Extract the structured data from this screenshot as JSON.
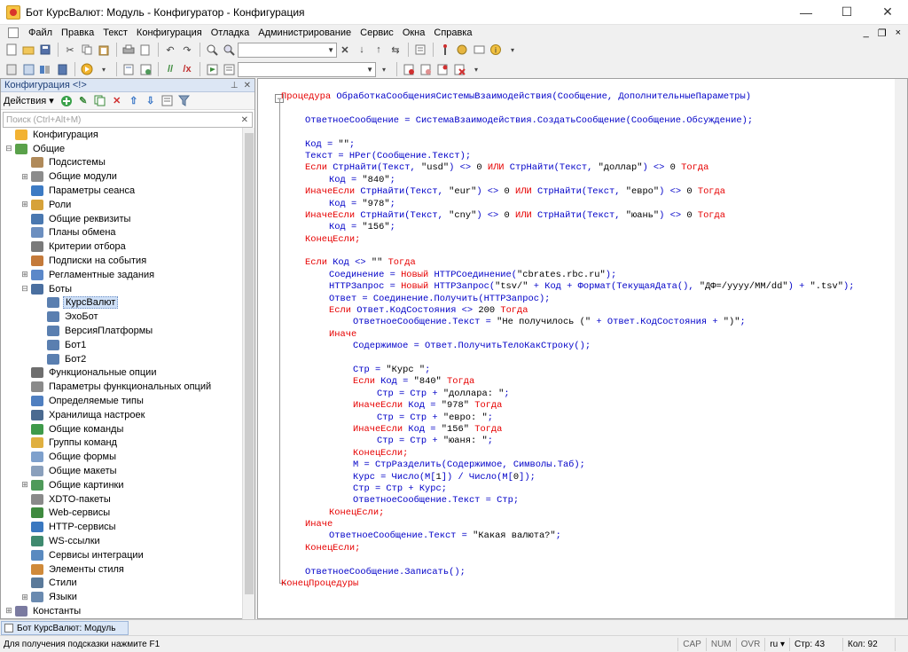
{
  "window": {
    "title": "Бот КурсВалют: Модуль - Конфигуратор - Конфигурация",
    "minimize": "—",
    "maximize": "☐",
    "close": "✕"
  },
  "menu": {
    "items": [
      "Файл",
      "Правка",
      "Текст",
      "Конфигурация",
      "Отладка",
      "Администрирование",
      "Сервис",
      "Окна",
      "Справка"
    ],
    "mdi_minimize": "_",
    "mdi_restore": "❐",
    "mdi_close": "×"
  },
  "config_panel": {
    "title": "Конфигурация <!>",
    "actions_label": "Действия ▾",
    "search_placeholder": "Поиск (Ctrl+Alt+M)",
    "tree": [
      {
        "label": "Конфигурация",
        "level": 0,
        "expander": "",
        "icon": "config-root-icon",
        "color": "#f2b233"
      },
      {
        "label": "Общие",
        "level": 0,
        "expander": "⊟",
        "icon": "common-icon",
        "color": "#5aa14a"
      },
      {
        "label": "Подсистемы",
        "level": 1,
        "expander": "",
        "icon": "subsystems-icon",
        "color": "#b08a5a"
      },
      {
        "label": "Общие модули",
        "level": 1,
        "expander": "⊞",
        "icon": "common-modules-icon",
        "color": "#8c8c8c"
      },
      {
        "label": "Параметры сеанса",
        "level": 1,
        "expander": "",
        "icon": "session-params-icon",
        "color": "#3d7bc4"
      },
      {
        "label": "Роли",
        "level": 1,
        "expander": "⊞",
        "icon": "roles-icon",
        "color": "#d6a23a"
      },
      {
        "label": "Общие реквизиты",
        "level": 1,
        "expander": "",
        "icon": "common-attributes-icon",
        "color": "#4a78b0"
      },
      {
        "label": "Планы обмена",
        "level": 1,
        "expander": "",
        "icon": "exchange-plans-icon",
        "color": "#6c8fc0"
      },
      {
        "label": "Критерии отбора",
        "level": 1,
        "expander": "",
        "icon": "filter-criteria-icon",
        "color": "#7a7a7a"
      },
      {
        "label": "Подписки на события",
        "level": 1,
        "expander": "",
        "icon": "event-subscriptions-icon",
        "color": "#c47a3a"
      },
      {
        "label": "Регламентные задания",
        "level": 1,
        "expander": "⊞",
        "icon": "scheduled-jobs-icon",
        "color": "#5b88c9"
      },
      {
        "label": "Боты",
        "level": 1,
        "expander": "⊟",
        "icon": "bots-icon",
        "color": "#4a6fa0"
      },
      {
        "label": "КурсВалют",
        "level": 2,
        "expander": "",
        "icon": "bot-icon",
        "color": "#5a7fb0",
        "selected": true
      },
      {
        "label": "ЭхоБот",
        "level": 2,
        "expander": "",
        "icon": "bot-icon",
        "color": "#5a7fb0"
      },
      {
        "label": "ВерсияПлатформы",
        "level": 2,
        "expander": "",
        "icon": "bot-icon",
        "color": "#5a7fb0"
      },
      {
        "label": "Бот1",
        "level": 2,
        "expander": "",
        "icon": "bot-icon",
        "color": "#5a7fb0"
      },
      {
        "label": "Бот2",
        "level": 2,
        "expander": "",
        "icon": "bot-icon",
        "color": "#5a7fb0"
      },
      {
        "label": "Функциональные опции",
        "level": 1,
        "expander": "",
        "icon": "functional-options-icon",
        "color": "#6e6e6e"
      },
      {
        "label": "Параметры функциональных опций",
        "level": 1,
        "expander": "",
        "icon": "functional-option-params-icon",
        "color": "#8a8a8a"
      },
      {
        "label": "Определяемые типы",
        "level": 1,
        "expander": "",
        "icon": "defined-types-icon",
        "color": "#4f7fc0"
      },
      {
        "label": "Хранилища настроек",
        "level": 1,
        "expander": "",
        "icon": "settings-storages-icon",
        "color": "#4a6a90"
      },
      {
        "label": "Общие команды",
        "level": 1,
        "expander": "",
        "icon": "common-commands-icon",
        "color": "#3f9a4a"
      },
      {
        "label": "Группы команд",
        "level": 1,
        "expander": "",
        "icon": "command-groups-icon",
        "color": "#e0b040"
      },
      {
        "label": "Общие формы",
        "level": 1,
        "expander": "",
        "icon": "common-forms-icon",
        "color": "#7ea0cc"
      },
      {
        "label": "Общие макеты",
        "level": 1,
        "expander": "",
        "icon": "common-templates-icon",
        "color": "#8aa0bc"
      },
      {
        "label": "Общие картинки",
        "level": 1,
        "expander": "⊞",
        "icon": "common-pictures-icon",
        "color": "#4f9a5a"
      },
      {
        "label": "XDTO-пакеты",
        "level": 1,
        "expander": "",
        "icon": "xdto-packages-icon",
        "color": "#8a8a8a"
      },
      {
        "label": "Web-сервисы",
        "level": 1,
        "expander": "",
        "icon": "web-services-icon",
        "color": "#3f8a3f"
      },
      {
        "label": "HTTP-сервисы",
        "level": 1,
        "expander": "",
        "icon": "http-services-icon",
        "color": "#3a78c0"
      },
      {
        "label": "WS-ссылки",
        "level": 1,
        "expander": "",
        "icon": "ws-references-icon",
        "color": "#3f8a6f"
      },
      {
        "label": "Сервисы интеграции",
        "level": 1,
        "expander": "",
        "icon": "integration-services-icon",
        "color": "#5a8ac0"
      },
      {
        "label": "Элементы стиля",
        "level": 1,
        "expander": "",
        "icon": "style-items-icon",
        "color": "#d08a3a"
      },
      {
        "label": "Стили",
        "level": 1,
        "expander": "",
        "icon": "styles-icon",
        "color": "#5a7a9a"
      },
      {
        "label": "Языки",
        "level": 1,
        "expander": "⊞",
        "icon": "languages-icon",
        "color": "#6a8ab0"
      },
      {
        "label": "Константы",
        "level": 0,
        "expander": "⊞",
        "icon": "constants-icon",
        "color": "#7a7aa0"
      }
    ]
  },
  "editor": {
    "fold_open": "−",
    "lines": [
      {
        "indent": 0,
        "parts": [
          [
            "k",
            "Процедура "
          ],
          [
            "t",
            "ОбработкаСообщенияСистемыВзаимодействия(Сообщение, ДополнительныеПараметры)"
          ]
        ]
      },
      {
        "indent": 0,
        "parts": []
      },
      {
        "indent": 1,
        "parts": [
          [
            "t",
            "ОтветноеСообщение = СистемаВзаимодействия.СоздатьСообщение(Сообщение.Обсуждение);"
          ]
        ]
      },
      {
        "indent": 0,
        "parts": []
      },
      {
        "indent": 1,
        "parts": [
          [
            "t",
            "Код = "
          ],
          [
            "s",
            "\"\""
          ],
          [
            "t",
            ";"
          ]
        ]
      },
      {
        "indent": 1,
        "parts": [
          [
            "t",
            "Текст = НРег(Сообщение.Текст);"
          ]
        ]
      },
      {
        "indent": 1,
        "parts": [
          [
            "k",
            "Если "
          ],
          [
            "t",
            "СтрНайти(Текст, "
          ],
          [
            "s",
            "\"usd\""
          ],
          [
            "t",
            ") <> "
          ],
          [
            "s",
            "0"
          ],
          [
            "k",
            " ИЛИ "
          ],
          [
            "t",
            "СтрНайти(Текст, "
          ],
          [
            "s",
            "\"доллар\""
          ],
          [
            "t",
            ") <> "
          ],
          [
            "s",
            "0"
          ],
          [
            "k",
            " Тогда"
          ]
        ]
      },
      {
        "indent": 2,
        "parts": [
          [
            "t",
            "Код = "
          ],
          [
            "s",
            "\"840\""
          ],
          [
            "t",
            ";"
          ]
        ]
      },
      {
        "indent": 1,
        "parts": [
          [
            "k",
            "ИначеЕсли "
          ],
          [
            "t",
            "СтрНайти(Текст, "
          ],
          [
            "s",
            "\"eur\""
          ],
          [
            "t",
            ") <> "
          ],
          [
            "s",
            "0"
          ],
          [
            "k",
            " ИЛИ "
          ],
          [
            "t",
            "СтрНайти(Текст, "
          ],
          [
            "s",
            "\"евро\""
          ],
          [
            "t",
            ") <> "
          ],
          [
            "s",
            "0"
          ],
          [
            "k",
            " Тогда"
          ]
        ]
      },
      {
        "indent": 2,
        "parts": [
          [
            "t",
            "Код = "
          ],
          [
            "s",
            "\"978\""
          ],
          [
            "t",
            ";"
          ]
        ]
      },
      {
        "indent": 1,
        "parts": [
          [
            "k",
            "ИначеЕсли "
          ],
          [
            "t",
            "СтрНайти(Текст, "
          ],
          [
            "s",
            "\"cny\""
          ],
          [
            "t",
            ") <> "
          ],
          [
            "s",
            "0"
          ],
          [
            "k",
            " ИЛИ "
          ],
          [
            "t",
            "СтрНайти(Текст, "
          ],
          [
            "s",
            "\"юань\""
          ],
          [
            "t",
            ") <> "
          ],
          [
            "s",
            "0"
          ],
          [
            "k",
            " Тогда"
          ]
        ]
      },
      {
        "indent": 2,
        "parts": [
          [
            "t",
            "Код = "
          ],
          [
            "s",
            "\"156\""
          ],
          [
            "t",
            ";"
          ]
        ]
      },
      {
        "indent": 1,
        "parts": [
          [
            "k",
            "КонецЕсли;"
          ]
        ]
      },
      {
        "indent": 0,
        "parts": []
      },
      {
        "indent": 1,
        "parts": [
          [
            "k",
            "Если "
          ],
          [
            "t",
            "Код <> "
          ],
          [
            "s",
            "\"\""
          ],
          [
            "k",
            " Тогда"
          ]
        ]
      },
      {
        "indent": 2,
        "parts": [
          [
            "t",
            "Соединение = "
          ],
          [
            "k",
            "Новый "
          ],
          [
            "t",
            "HTTPСоединение("
          ],
          [
            "s",
            "\"cbrates.rbc.ru\""
          ],
          [
            "t",
            ");"
          ]
        ]
      },
      {
        "indent": 2,
        "parts": [
          [
            "t",
            "HTTPЗапрос = "
          ],
          [
            "k",
            "Новый "
          ],
          [
            "t",
            "HTTPЗапрос("
          ],
          [
            "s",
            "\"tsv/\""
          ],
          [
            "t",
            " + Код + Формат(ТекущаяДата(), "
          ],
          [
            "s",
            "\"ДФ=/yyyy/MM/dd\""
          ],
          [
            "t",
            ") + "
          ],
          [
            "s",
            "\".tsv\""
          ],
          [
            "t",
            ");"
          ]
        ]
      },
      {
        "indent": 2,
        "parts": [
          [
            "t",
            "Ответ = Соединение.Получить(HTTPЗапрос);"
          ]
        ]
      },
      {
        "indent": 2,
        "parts": [
          [
            "k",
            "Если "
          ],
          [
            "t",
            "Ответ.КодСостояния <> "
          ],
          [
            "s",
            "200"
          ],
          [
            "k",
            " Тогда"
          ]
        ]
      },
      {
        "indent": 3,
        "parts": [
          [
            "t",
            "ОтветноеСообщение.Текст = "
          ],
          [
            "s",
            "\"Не получилось (\""
          ],
          [
            "t",
            " + Ответ.КодСостояния + "
          ],
          [
            "s",
            "\")\""
          ],
          [
            "t",
            ";"
          ]
        ]
      },
      {
        "indent": 2,
        "parts": [
          [
            "k",
            "Иначе"
          ]
        ]
      },
      {
        "indent": 3,
        "parts": [
          [
            "t",
            "Содержимое = Ответ.ПолучитьТелоКакСтроку();"
          ]
        ]
      },
      {
        "indent": 0,
        "parts": []
      },
      {
        "indent": 3,
        "parts": [
          [
            "t",
            "Стр = "
          ],
          [
            "s",
            "\"Курс \""
          ],
          [
            "t",
            ";"
          ]
        ]
      },
      {
        "indent": 3,
        "parts": [
          [
            "k",
            "Если "
          ],
          [
            "t",
            "Код = "
          ],
          [
            "s",
            "\"840\""
          ],
          [
            "k",
            " Тогда"
          ]
        ]
      },
      {
        "indent": 4,
        "parts": [
          [
            "t",
            "Стр = Стр + "
          ],
          [
            "s",
            "\"доллара: \""
          ],
          [
            "t",
            ";"
          ]
        ]
      },
      {
        "indent": 3,
        "parts": [
          [
            "k",
            "ИначеЕсли "
          ],
          [
            "t",
            "Код = "
          ],
          [
            "s",
            "\"978\""
          ],
          [
            "k",
            " Тогда"
          ]
        ]
      },
      {
        "indent": 4,
        "parts": [
          [
            "t",
            "Стр = Стр + "
          ],
          [
            "s",
            "\"евро: \""
          ],
          [
            "t",
            ";"
          ]
        ]
      },
      {
        "indent": 3,
        "parts": [
          [
            "k",
            "ИначеЕсли "
          ],
          [
            "t",
            "Код = "
          ],
          [
            "s",
            "\"156\""
          ],
          [
            "k",
            " Тогда"
          ]
        ]
      },
      {
        "indent": 4,
        "parts": [
          [
            "t",
            "Стр = Стр + "
          ],
          [
            "s",
            "\"юаня: \""
          ],
          [
            "t",
            ";"
          ]
        ]
      },
      {
        "indent": 3,
        "parts": [
          [
            "k",
            "КонецЕсли;"
          ]
        ]
      },
      {
        "indent": 3,
        "parts": [
          [
            "t",
            "М = СтрРазделить(Содержимое, Символы.Таб);"
          ]
        ]
      },
      {
        "indent": 3,
        "parts": [
          [
            "t",
            "Курс = Число(М["
          ],
          [
            "s",
            "1"
          ],
          [
            "t",
            "]) / Число(М["
          ],
          [
            "s",
            "0"
          ],
          [
            "t",
            "]);"
          ]
        ]
      },
      {
        "indent": 3,
        "parts": [
          [
            "t",
            "Стр = Стр + Курс;"
          ]
        ]
      },
      {
        "indent": 3,
        "parts": [
          [
            "t",
            "ОтветноеСообщение.Текст = Стр;"
          ]
        ]
      },
      {
        "indent": 2,
        "parts": [
          [
            "k",
            "КонецЕсли;"
          ]
        ]
      },
      {
        "indent": 1,
        "parts": [
          [
            "k",
            "Иначе"
          ]
        ]
      },
      {
        "indent": 2,
        "parts": [
          [
            "t",
            "ОтветноеСообщение.Текст = "
          ],
          [
            "s",
            "\"Какая валюта?\""
          ],
          [
            "t",
            ";"
          ]
        ]
      },
      {
        "indent": 1,
        "parts": [
          [
            "k",
            "КонецЕсли;"
          ]
        ]
      },
      {
        "indent": 0,
        "parts": []
      },
      {
        "indent": 1,
        "parts": [
          [
            "t",
            "ОтветноеСообщение.Записать();"
          ]
        ]
      },
      {
        "indent": 0,
        "parts": [
          [
            "k",
            "КонецПроцедуры"
          ]
        ]
      }
    ]
  },
  "taskbar": {
    "active_window": "Бот КурсВалют: Модуль"
  },
  "statusbar": {
    "hint": "Для получения подсказки нажмите F1",
    "cap": "CAP",
    "num": "NUM",
    "ovr": "OVR",
    "lang": "ru ▾",
    "line": "Стр: 43",
    "col": "Кол: 92"
  },
  "colors": {
    "keyword": "#e60000",
    "identifier": "#0000c8",
    "literal": "#000000",
    "selection": "#cfe0f7",
    "panel_header": "#dce6f4"
  }
}
